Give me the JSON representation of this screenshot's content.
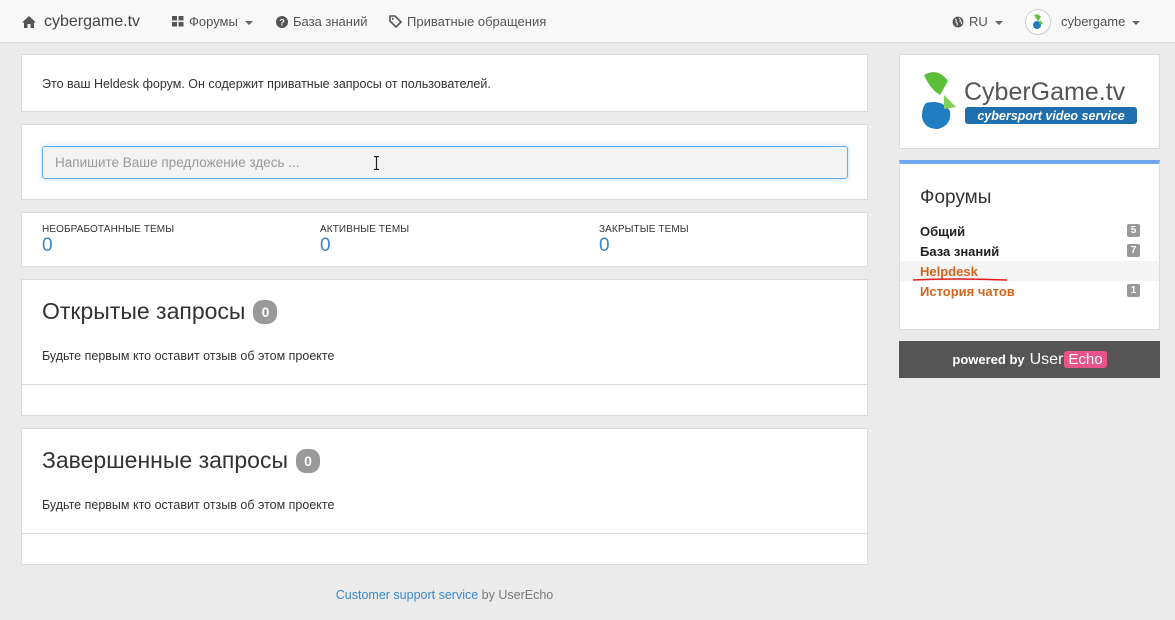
{
  "navbar": {
    "brand": "cybergame.tv",
    "forums_label": "Форумы",
    "knowledge_label": "База знаний",
    "private_label": "Приватные обращения",
    "lang_label": "RU",
    "user_label": "cybergame"
  },
  "intro": {
    "text": "Это ваш Heldesk форум. Он содержит приватные запросы от пользователей."
  },
  "search": {
    "placeholder": "Напишите Ваше предложение здесь ..."
  },
  "stats": [
    {
      "label": "Необработанные темы",
      "value": "0"
    },
    {
      "label": "Активные темы",
      "value": "0"
    },
    {
      "label": "Закрытые темы",
      "value": "0"
    }
  ],
  "open_requests": {
    "title": "Открытые запросы",
    "count": "0",
    "empty_text": "Будьте первым кто оставит отзыв об этом проекте"
  },
  "closed_requests": {
    "title": "Завершенные запросы",
    "count": "0",
    "empty_text": "Будьте первым кто оставит отзыв об этом проекте"
  },
  "footer": {
    "link_text": "Customer support service",
    "by_text": "by UserEcho"
  },
  "sidebar": {
    "logo": {
      "title": "CyberGame.tv",
      "subtitle": "cybersport video service"
    },
    "forums_title": "Форумы",
    "forums": [
      {
        "name": "Общий",
        "count": "5"
      },
      {
        "name": "База знаний",
        "count": "7"
      },
      {
        "name": "Helpdesk",
        "count": ""
      },
      {
        "name": "История чатов",
        "count": "1"
      }
    ]
  },
  "powered": {
    "prefix": "powered by",
    "user": "User",
    "echo": "Echo"
  },
  "colors": {
    "accent_blue": "#3a87c8",
    "active_orange": "#d4661c",
    "forums_border": "#6ea6ef",
    "logo_green": "#5cbf3a",
    "logo_blue": "#1f7dc1",
    "userecho_pink": "#e8538a"
  },
  "icons": {
    "brand": "home-icon",
    "forums": "grid-icon",
    "knowledge": "question-circle-icon",
    "private": "tag-icon",
    "lang": "globe-icon"
  }
}
